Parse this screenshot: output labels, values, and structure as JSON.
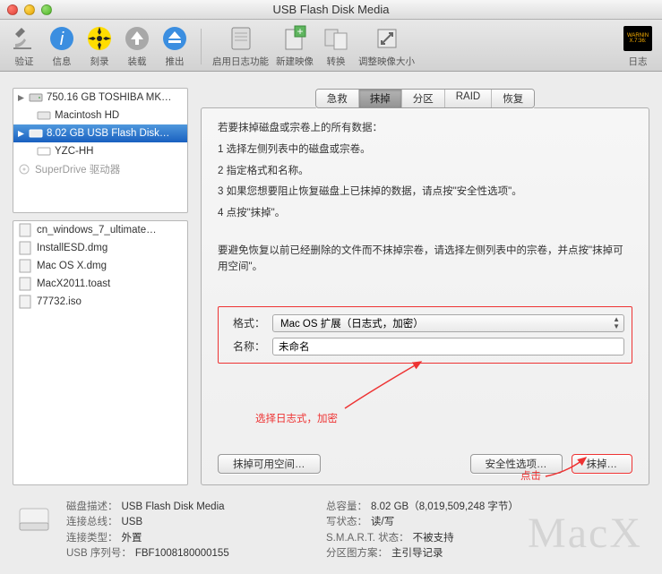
{
  "window": {
    "title": "USB Flash Disk Media"
  },
  "toolbar": {
    "verify": "验证",
    "info": "信息",
    "burn": "刻录",
    "mount": "装载",
    "eject": "推出",
    "enable_journal": "启用日志功能",
    "new_image": "新建映像",
    "convert": "转换",
    "resize": "调整映像大小",
    "log": "日志"
  },
  "sidebar": {
    "disk1": "750.16 GB TOSHIBA MK…",
    "disk1_vol1": "Macintosh HD",
    "disk2": "8.02 GB USB Flash Disk…",
    "disk2_vol1": "YZC-HH",
    "optical": "SuperDrive 驱动器"
  },
  "files": {
    "f1": "cn_windows_7_ultimate…",
    "f2": "InstallESD.dmg",
    "f3": "Mac OS X.dmg",
    "f4": "MacX2011.toast",
    "f5": "77732.iso"
  },
  "tabs": {
    "first_aid": "急救",
    "erase": "抹掉",
    "partition": "分区",
    "raid": "RAID",
    "restore": "恢复"
  },
  "instructions": {
    "intro": "若要抹掉磁盘或宗卷上的所有数据：",
    "s1": "1  选择左侧列表中的磁盘或宗卷。",
    "s2": "2  指定格式和名称。",
    "s3": "3  如果您想要阻止恢复磁盘上已抹掉的数据，请点按\"安全性选项\"。",
    "s4": "4  点按\"抹掉\"。",
    "note": "要避免恢复以前已经删除的文件而不抹掉宗卷，请选择左侧列表中的宗卷，并点按\"抹掉可用空间\"。"
  },
  "form": {
    "format_label": "格式：",
    "format_value": "Mac OS 扩展（日志式，加密）",
    "name_label": "名称：",
    "name_value": "未命名"
  },
  "annotations": {
    "choose_format": "选择日志式，加密",
    "click": "点击"
  },
  "buttons": {
    "erase_free": "抹掉可用空间…",
    "security": "安全性选项…",
    "erase": "抹掉…"
  },
  "footer": {
    "desc_k": "磁盘描述：",
    "desc_v": "USB Flash Disk Media",
    "bus_k": "连接总线：",
    "bus_v": "USB",
    "type_k": "连接类型：",
    "type_v": "外置",
    "serial_k": "USB 序列号：",
    "serial_v": "FBF1008180000155",
    "cap_k": "总容量：",
    "cap_v": "8.02 GB（8,019,509,248 字节）",
    "rw_k": "写状态：",
    "rw_v": "读/写",
    "smart_k": "S.M.A.R.T. 状态：",
    "smart_v": "不被支持",
    "map_k": "分区图方案：",
    "map_v": "主引导记录"
  },
  "ghost": "MacX",
  "badge": {
    "l1": "WARNIN",
    "l2": "X.7:36:"
  }
}
